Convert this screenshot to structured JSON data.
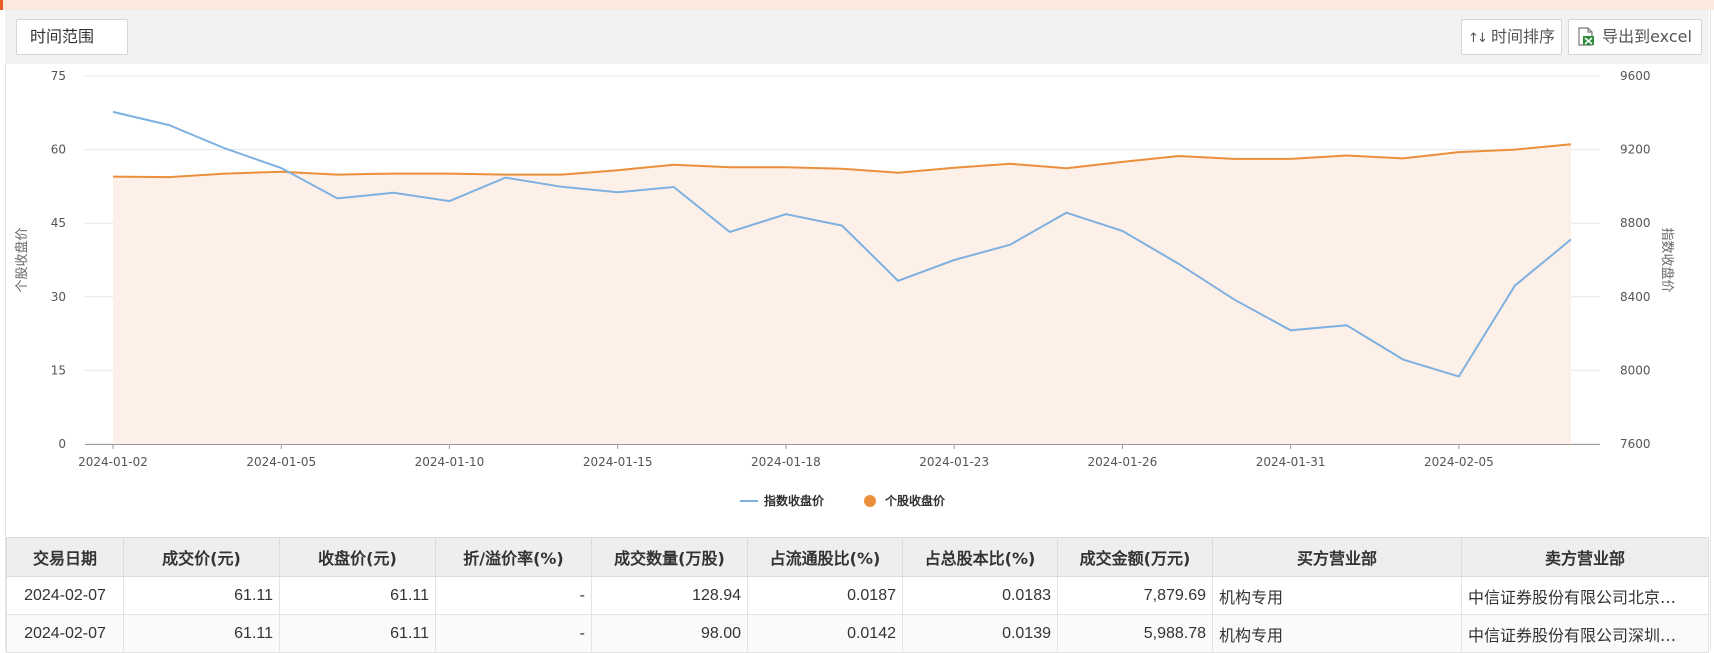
{
  "toolbar": {
    "range_label": "时间范围",
    "sort_label": "时间排序",
    "export_label": "导出到excel"
  },
  "colors": {
    "index_line": "#7eb1e0",
    "stock_line": "#eb8f3c",
    "area_fill": "#fdf0e8",
    "grid": "#e6e6e6"
  },
  "chart_data": {
    "type": "line",
    "x": [
      "2024-01-02",
      "2024-01-03",
      "2024-01-04",
      "2024-01-05",
      "2024-01-08",
      "2024-01-09",
      "2024-01-10",
      "2024-01-11",
      "2024-01-12",
      "2024-01-15",
      "2024-01-16",
      "2024-01-17",
      "2024-01-18",
      "2024-01-19",
      "2024-01-22",
      "2024-01-23",
      "2024-01-24",
      "2024-01-25",
      "2024-01-26",
      "2024-01-29",
      "2024-01-30",
      "2024-01-31",
      "2024-02-01",
      "2024-02-02",
      "2024-02-05",
      "2024-02-06",
      "2024-02-07"
    ],
    "xticks": [
      "2024-01-02",
      "2024-01-05",
      "2024-01-10",
      "2024-01-15",
      "2024-01-18",
      "2024-01-23",
      "2024-01-26",
      "2024-01-31",
      "2024-02-05"
    ],
    "left_axis": {
      "label": "个股收盘价",
      "ticks": [
        0,
        15,
        30,
        45,
        60,
        75
      ],
      "range": [
        0,
        75
      ]
    },
    "right_axis": {
      "label": "指数收盘价",
      "ticks": [
        7600,
        8000,
        8400,
        8800,
        9200,
        9600
      ],
      "range": [
        7600,
        9600
      ]
    },
    "series": [
      {
        "name": "指数收盘价",
        "axis": "right",
        "style": "line",
        "values": [
          9405,
          9333,
          9206,
          9100,
          8935,
          8965,
          8920,
          9048,
          8998,
          8968,
          8997,
          8752,
          8849,
          8787,
          8487,
          8600,
          8683,
          8857,
          8758,
          8580,
          8384,
          8218,
          8245,
          8060,
          7967,
          8461,
          8712
        ]
      },
      {
        "name": "个股收盘价",
        "axis": "left",
        "style": "area",
        "values": [
          54.5,
          54.4,
          55.1,
          55.5,
          54.9,
          55.1,
          55.1,
          54.9,
          54.9,
          55.8,
          56.9,
          56.4,
          56.4,
          56.1,
          55.3,
          56.3,
          57.1,
          56.2,
          57.5,
          58.7,
          58.1,
          58.1,
          58.8,
          58.2,
          59.5,
          60.0,
          61.1
        ]
      }
    ],
    "legend_position": "bottom-center",
    "grid": true
  },
  "table": {
    "columns": [
      "交易日期",
      "成交价(元)",
      "收盘价(元)",
      "折/溢价率(%)",
      "成交数量(万股)",
      "占流通股比(%)",
      "占总股本比(%)",
      "成交金额(万元)",
      "买方营业部",
      "卖方营业部"
    ],
    "rows": [
      [
        "2024-02-07",
        "61.11",
        "61.11",
        "-",
        "128.94",
        "0.0187",
        "0.0183",
        "7,879.69",
        "机构专用",
        "中信证券股份有限公司北京…"
      ],
      [
        "2024-02-07",
        "61.11",
        "61.11",
        "-",
        "98.00",
        "0.0142",
        "0.0139",
        "5,988.78",
        "机构专用",
        "中信证券股份有限公司深圳…"
      ]
    ]
  }
}
